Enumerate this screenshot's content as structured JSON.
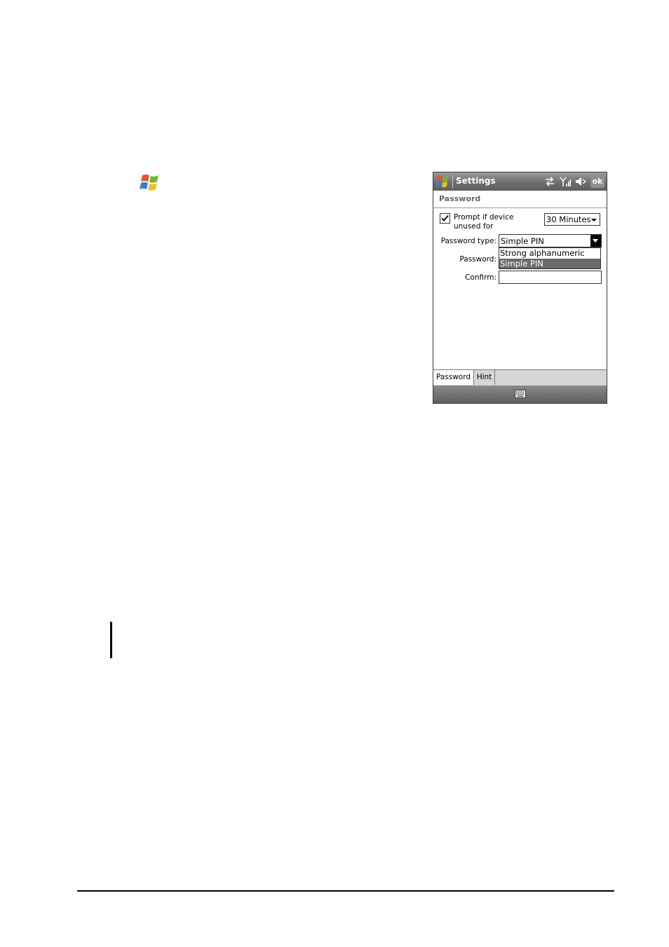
{
  "device": {
    "titlebar": {
      "title": "Settings",
      "ok_label": "ok",
      "icons": [
        "windows-logo-icon",
        "sync-arrows-icon",
        "signal-antenna-icon",
        "speaker-muted-icon"
      ]
    },
    "section_title": "Password",
    "prompt": {
      "checked": true,
      "label": "Prompt if device unused for",
      "selected_value": "30 Minutes"
    },
    "password_type": {
      "label": "Password type:",
      "selected_value": "Simple PIN",
      "options": [
        "Strong alphanumeric",
        "Simple PIN"
      ],
      "highlighted_option": "Simple PIN"
    },
    "password_label": "Password:",
    "confirm_label": "Confirm:",
    "tabs": [
      {
        "label": "Password",
        "active": true
      },
      {
        "label": "Hint",
        "active": false
      }
    ],
    "menubar": {
      "icon": "keyboard-icon"
    }
  },
  "page": {
    "start_icon": "windows-start-icon"
  },
  "colors": {
    "titlebar": "#6e6e6e",
    "highlight": "#6a6a6a",
    "tab_strip": "#d6d6d6"
  }
}
